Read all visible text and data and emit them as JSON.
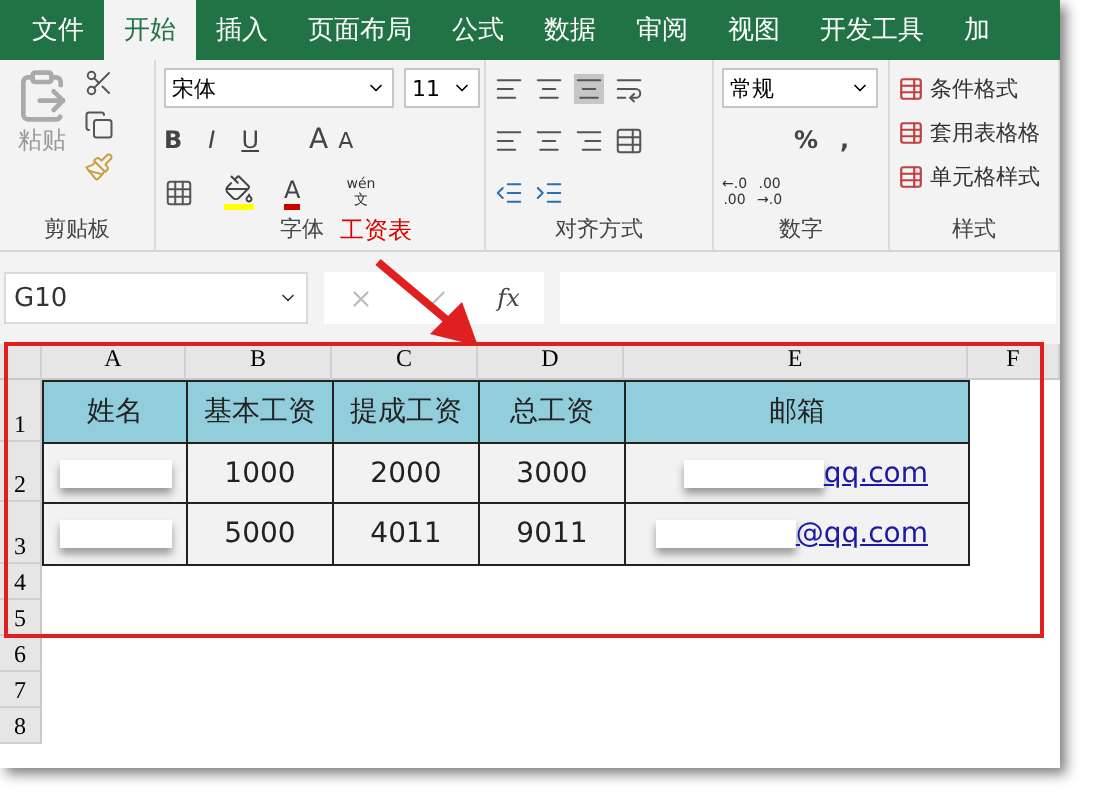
{
  "tabs": [
    {
      "label": "文件",
      "selected": false
    },
    {
      "label": "开始",
      "selected": true
    },
    {
      "label": "插入",
      "selected": false
    },
    {
      "label": "页面布局",
      "selected": false
    },
    {
      "label": "公式",
      "selected": false
    },
    {
      "label": "数据",
      "selected": false
    },
    {
      "label": "审阅",
      "selected": false
    },
    {
      "label": "视图",
      "selected": false
    },
    {
      "label": "开发工具",
      "selected": false
    },
    {
      "label": "加",
      "selected": false
    }
  ],
  "ribbon": {
    "clipboard": {
      "paste_label": "粘贴",
      "label": "剪贴板"
    },
    "font": {
      "font_name": "宋体",
      "font_size": "11",
      "bold": "B",
      "italic": "I",
      "underline": "U",
      "grow": "A",
      "shrink": "A",
      "font_color": "A",
      "phonetic_top": "wén",
      "phonetic_bottom": "文",
      "label": "字体"
    },
    "alignment": {
      "label": "对齐方式"
    },
    "number": {
      "format": "常规",
      "percent": "%",
      "comma": ",",
      "dec_increase": [
        "←.0",
        ".00"
      ],
      "dec_decrease": [
        ".00",
        "→.0"
      ],
      "label": "数字"
    },
    "styles": {
      "items": [
        "条件格式",
        "套用表格格",
        "单元格样式"
      ],
      "label": "样式"
    }
  },
  "annotation": {
    "label": "工资表"
  },
  "formula_bar": {
    "name_box": "G10",
    "fx": "fx"
  },
  "sheet": {
    "columns": [
      "A",
      "B",
      "C",
      "D",
      "E",
      "F"
    ],
    "rows": [
      "1",
      "2",
      "3",
      "4",
      "5",
      "6",
      "7",
      "8"
    ],
    "table": {
      "header": [
        "姓名",
        "基本工资",
        "提成工资",
        "总工资",
        "邮箱"
      ],
      "rows": [
        {
          "salary": "1000",
          "commission": "2000",
          "total": "3000",
          "email": "qq.com"
        },
        {
          "salary": "5000",
          "commission": "4011",
          "total": "9011",
          "email": "@qq.com"
        }
      ]
    }
  }
}
